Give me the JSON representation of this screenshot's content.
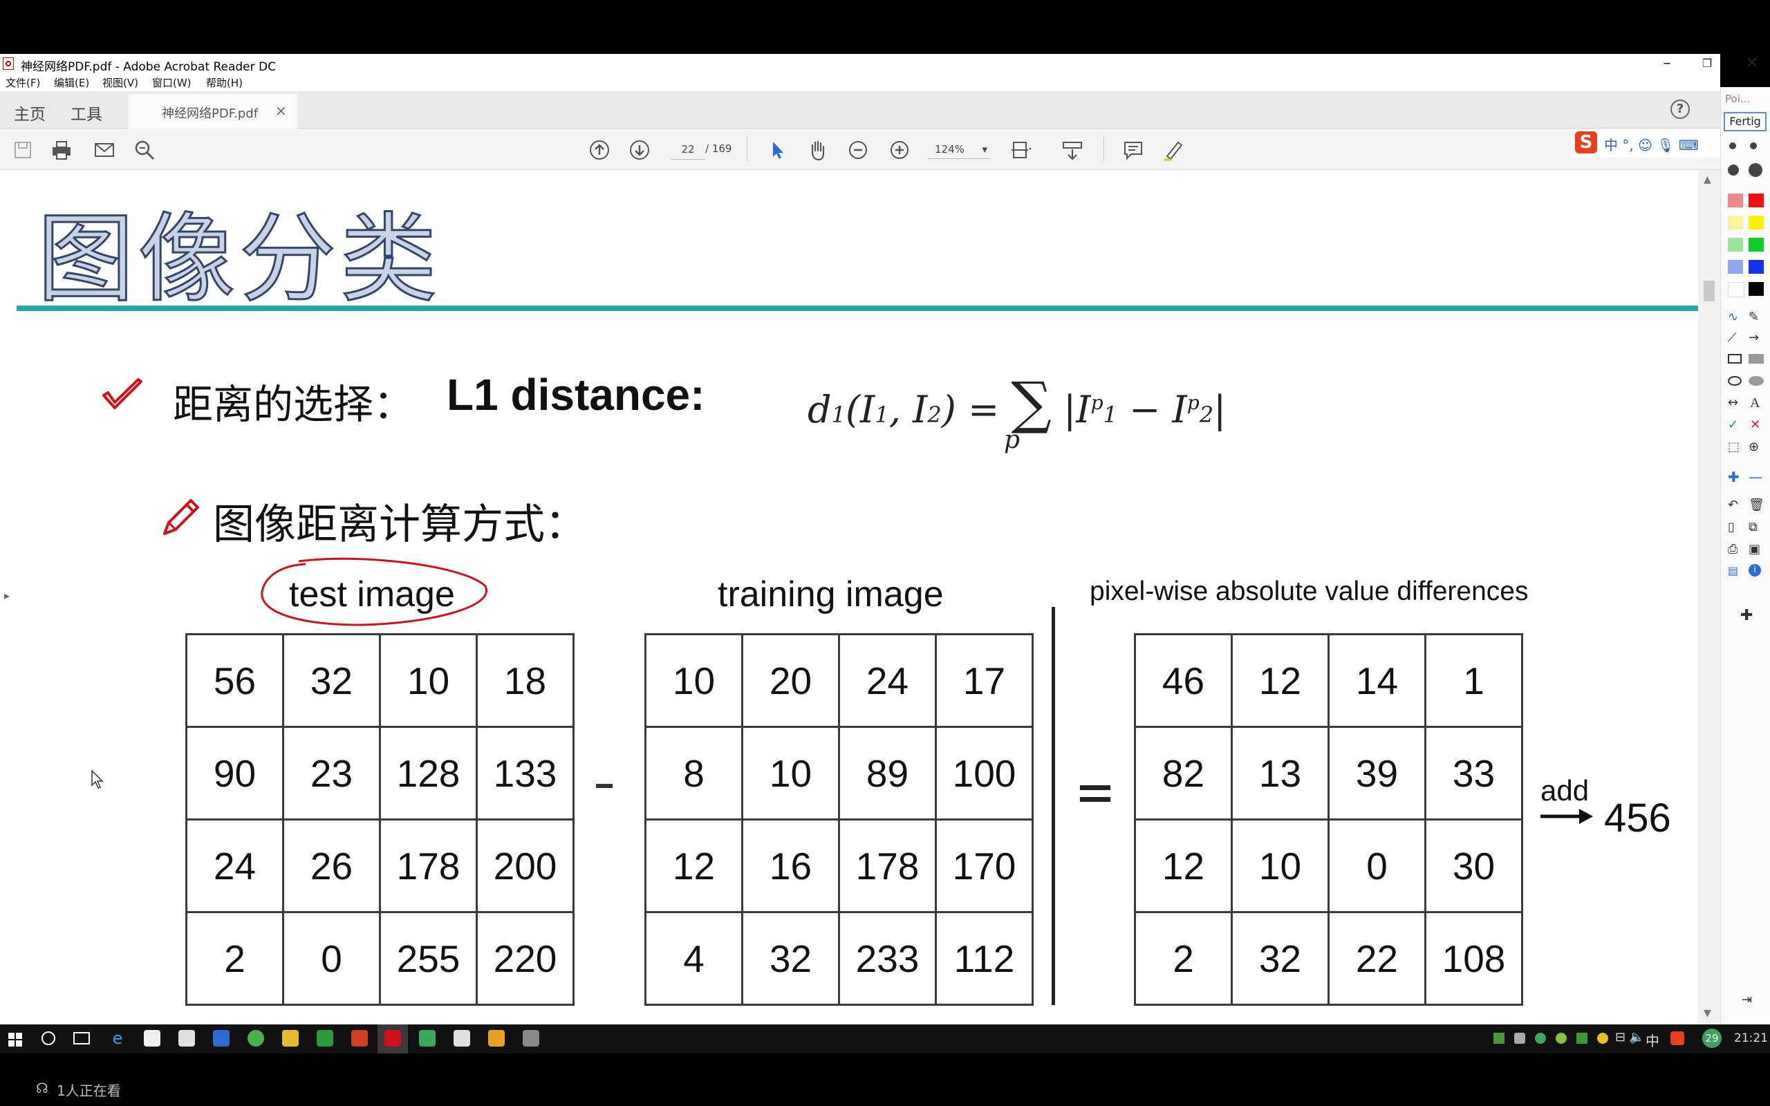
{
  "window": {
    "title": "神经网络PDF.pdf - Adobe Acrobat Reader DC",
    "controls": [
      "–",
      "❐",
      "✕"
    ]
  },
  "menu": [
    "文件(F)",
    "编辑(E)",
    "视图(V)",
    "窗口(W)",
    "帮助(H)"
  ],
  "tabs": {
    "home": "主页",
    "tools": "工具",
    "document": "神经网络PDF.pdf",
    "close": "×",
    "help": "?"
  },
  "toolbar": {
    "current_page": "22",
    "page_total": "/ 169",
    "zoom": "124%",
    "zoom_caret": "▾"
  },
  "slide": {
    "title": "图像分类",
    "bullet1_label": "距离的选择：",
    "bullet1_metric": "L1 distance:",
    "formula_sum_index": "p",
    "bullet2_label": "图像距离计算方式：",
    "labels": {
      "test": "test image",
      "train": "training image",
      "diff": "pixel-wise absolute value differences"
    },
    "matrices": {
      "test": [
        [
          "56",
          "32",
          "10",
          "18"
        ],
        [
          "90",
          "23",
          "128",
          "133"
        ],
        [
          "24",
          "26",
          "178",
          "200"
        ],
        [
          "2",
          "0",
          "255",
          "220"
        ]
      ],
      "train": [
        [
          "10",
          "20",
          "24",
          "17"
        ],
        [
          "8",
          "10",
          "89",
          "100"
        ],
        [
          "12",
          "16",
          "178",
          "170"
        ],
        [
          "4",
          "32",
          "233",
          "112"
        ]
      ],
      "diff": [
        [
          "46",
          "12",
          "14",
          "1"
        ],
        [
          "82",
          "13",
          "39",
          "33"
        ],
        [
          "12",
          "10",
          "0",
          "30"
        ],
        [
          "2",
          "32",
          "22",
          "108"
        ]
      ]
    },
    "add_label": "add",
    "sum_result": "456",
    "accent_color": "#2aa5a5",
    "annotation_color": "#d0101a"
  },
  "palette": {
    "title": "Poi...",
    "done": "Fertig"
  },
  "ime": {
    "logo": "S",
    "text": "中 °, ☺ 🎙 ⌨"
  },
  "taskbar": {
    "lang": "中",
    "badge": "29",
    "time": "21:21"
  },
  "stream": {
    "viewers": "1人正在看"
  }
}
